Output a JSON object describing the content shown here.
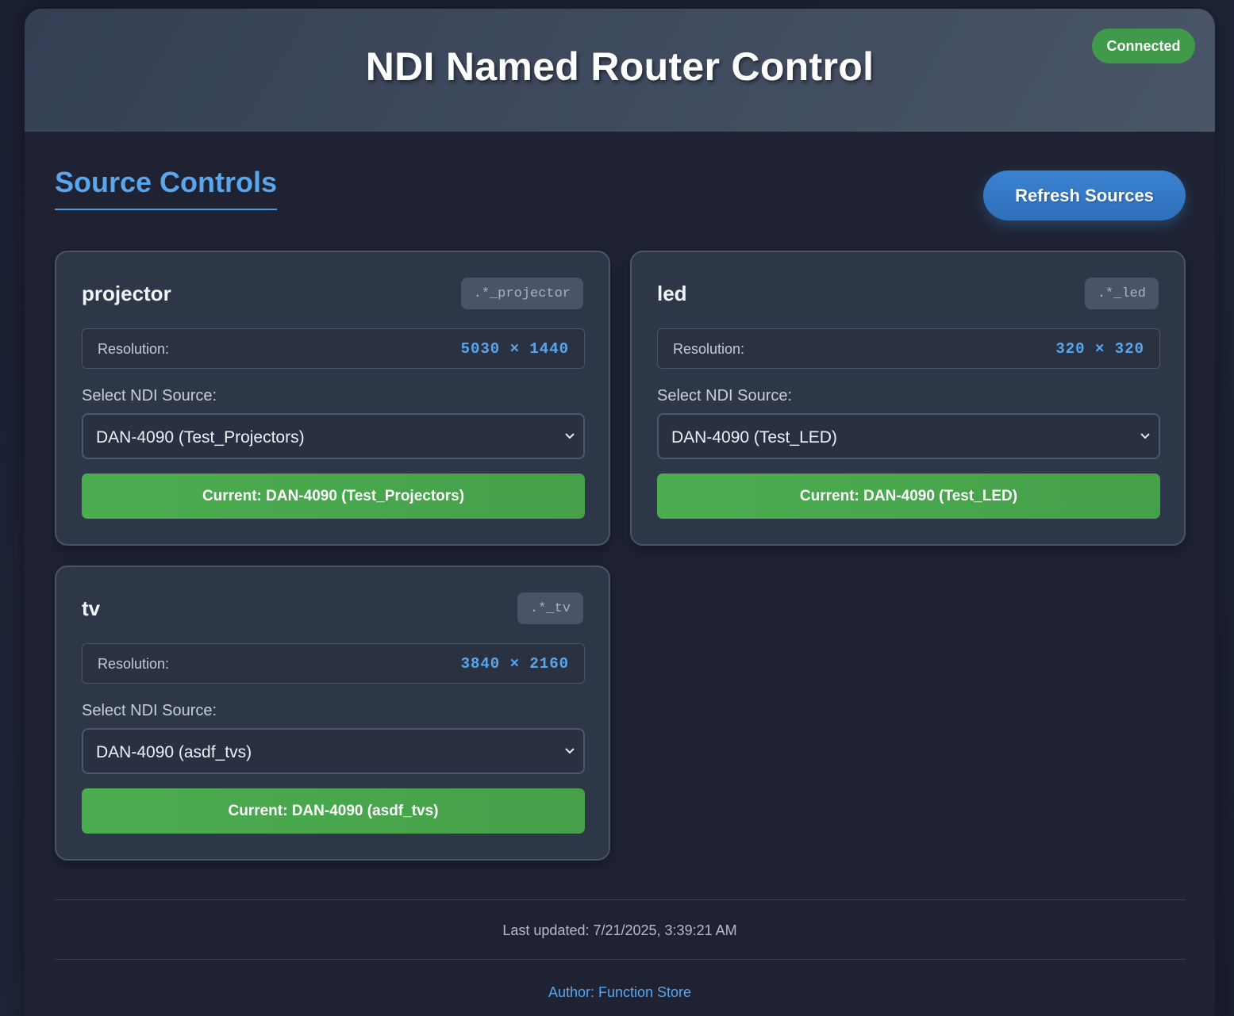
{
  "header": {
    "title": "NDI Named Router Control",
    "status": "Connected"
  },
  "section": {
    "title": "Source Controls",
    "refresh_label": "Refresh Sources"
  },
  "cards": [
    {
      "name": "projector",
      "pattern": ".*_projector",
      "resolution_label": "Resolution:",
      "resolution": "5030 × 1440",
      "select_label": "Select NDI Source:",
      "selected_source": "DAN-4090 (Test_Projectors)",
      "current": "Current: DAN-4090 (Test_Projectors)"
    },
    {
      "name": "led",
      "pattern": ".*_led",
      "resolution_label": "Resolution:",
      "resolution": "320 × 320",
      "select_label": "Select NDI Source:",
      "selected_source": "DAN-4090 (Test_LED)",
      "current": "Current: DAN-4090 (Test_LED)"
    },
    {
      "name": "tv",
      "pattern": ".*_tv",
      "resolution_label": "Resolution:",
      "resolution": "3840 × 2160",
      "select_label": "Select NDI Source:",
      "selected_source": "DAN-4090 (asdf_tvs)",
      "current": "Current: DAN-4090 (asdf_tvs)"
    }
  ],
  "footer": {
    "last_updated": "Last updated: 7/21/2025, 3:39:21 AM",
    "author": "Author: Function Store"
  },
  "colors": {
    "accent": "#5aa6ec",
    "success": "#4cad50",
    "status": "#3f9a4a"
  }
}
